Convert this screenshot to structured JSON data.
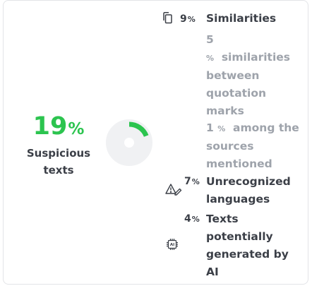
{
  "score": {
    "value": "19",
    "unit": "%",
    "label": "Suspicious texts",
    "fraction": 0.19
  },
  "colors": {
    "accent": "#2cc44f",
    "ring_bg": "#f0f1f3",
    "text": "#3b3f47",
    "muted": "#9ea3ab"
  },
  "metrics": [
    {
      "icon": "copy-icon",
      "value": "9",
      "unit": "%",
      "label": "Similarities",
      "details": [
        {
          "value": "5",
          "unit": "%",
          "text": "similarities between quotation marks"
        },
        {
          "value": "1",
          "unit": "%",
          "text": "among the sources mentioned"
        }
      ]
    },
    {
      "icon": "warning-pencil-icon",
      "value": "7",
      "unit": "%",
      "label": "Unrecognized languages"
    },
    {
      "icon": "ai-chip-icon",
      "value": "4",
      "unit": "%",
      "label": "Texts potentially generated by AI"
    }
  ]
}
